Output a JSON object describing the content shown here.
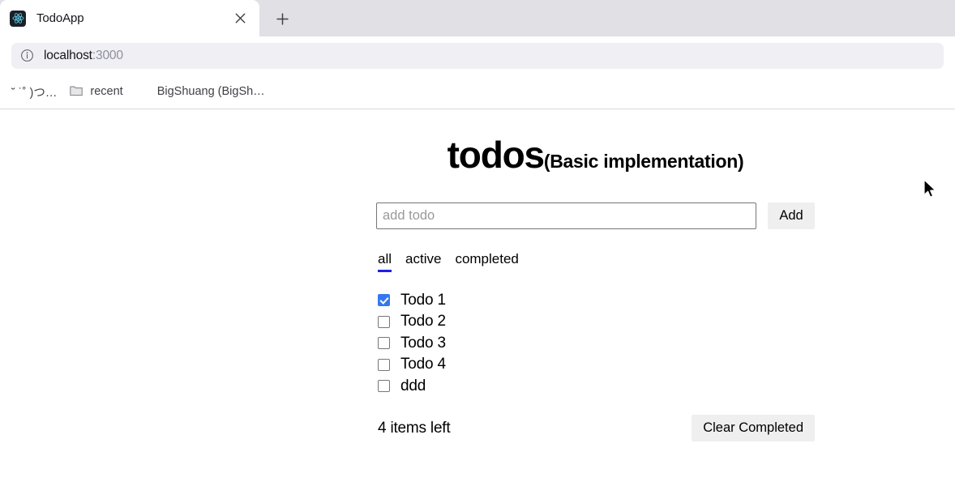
{
  "browser": {
    "tab": {
      "title": "TodoApp",
      "favicon_name": "react-logo-icon",
      "close_label": "×"
    },
    "new_tab_label": "+",
    "url_bar": {
      "info_icon": "info-circle-icon",
      "host": "localhost",
      "port": ":3000"
    },
    "bookmarks": [
      {
        "label": "˘ ˙˚ )つ…",
        "icon": ""
      },
      {
        "label": "recent",
        "icon": "folder-icon"
      },
      {
        "label": "BigShuang (BigSh…",
        "icon": ""
      }
    ]
  },
  "app": {
    "title_main": "todos",
    "title_sub": "(Basic implementation)",
    "input": {
      "placeholder": "add todo",
      "value": ""
    },
    "add_button_label": "Add",
    "filters": [
      {
        "label": "all",
        "active": true
      },
      {
        "label": "active",
        "active": false
      },
      {
        "label": "completed",
        "active": false
      }
    ],
    "todos": [
      {
        "label": "Todo 1",
        "completed": true
      },
      {
        "label": "Todo 2",
        "completed": false
      },
      {
        "label": "Todo 3",
        "completed": false
      },
      {
        "label": "Todo 4",
        "completed": false
      },
      {
        "label": "ddd",
        "completed": false
      }
    ],
    "items_left_text": "4 items left",
    "clear_completed_label": "Clear Completed"
  },
  "colors": {
    "accent_blue": "#1f1fe0",
    "checkbox_blue": "#3478f0",
    "chrome_gray": "#e1e0e5",
    "urlbar_gray": "#f0f0f4",
    "button_gray": "#efefef"
  }
}
